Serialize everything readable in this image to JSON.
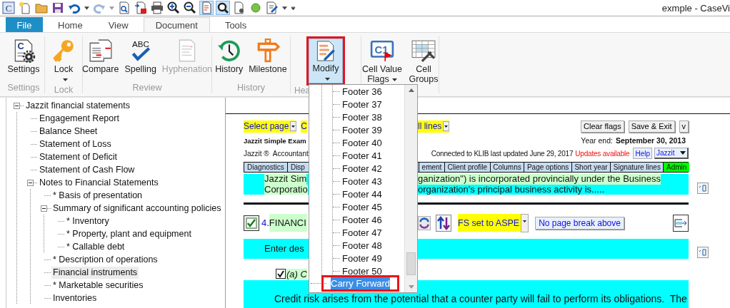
{
  "app_icon_text": "C",
  "window": {
    "title": "exmple - CaseVi"
  },
  "ribbon_tabs": [
    {
      "label": "File",
      "kind": "menu",
      "selected": false
    },
    {
      "label": "Home",
      "kind": "tab",
      "selected": false
    },
    {
      "label": "View",
      "kind": "tab",
      "selected": false
    },
    {
      "label": "Document",
      "kind": "tab",
      "selected": true
    },
    {
      "label": "Tools",
      "kind": "tab",
      "selected": false
    }
  ],
  "ribbon_groups": [
    {
      "label": "Settings",
      "buttons": [
        {
          "label": "Settings",
          "icon_text": "C",
          "dropdown": false,
          "disabled": false,
          "pressed": false,
          "outlined": false
        }
      ]
    },
    {
      "label": "Lock",
      "buttons": [
        {
          "label": "Lock",
          "dropdown": true,
          "disabled": false,
          "pressed": false,
          "outlined": false
        }
      ]
    },
    {
      "label": "Review",
      "buttons": [
        {
          "label": "Compare",
          "dropdown": false,
          "disabled": false,
          "pressed": false,
          "outlined": false
        },
        {
          "label": "Spelling",
          "icon_text": "ABC",
          "dropdown": false,
          "disabled": false,
          "pressed": false,
          "outlined": false
        },
        {
          "label": "Hyphenation",
          "dropdown": false,
          "disabled": true,
          "pressed": false,
          "outlined": false
        }
      ]
    },
    {
      "label": "History",
      "buttons": [
        {
          "label": "History",
          "dropdown": false,
          "disabled": false,
          "pressed": false,
          "outlined": false
        },
        {
          "label": "Milestone",
          "dropdown": false,
          "disabled": false,
          "pressed": false,
          "outlined": false
        }
      ]
    },
    {
      "label": "Hea",
      "buttons": [
        {
          "label": "Modify",
          "dropdown": true,
          "disabled": false,
          "pressed": true,
          "outlined": true
        }
      ]
    },
    {
      "buttons": [
        {
          "label": "Cell Value Flags",
          "icon_text": "C1",
          "dropdown": true,
          "disabled": false,
          "pressed": false,
          "outlined": false
        },
        {
          "label": "Cell Groups",
          "dropdown": false,
          "disabled": false,
          "pressed": false,
          "outlined": false
        }
      ]
    }
  ],
  "tree": [
    {
      "label": "Jazzit financial statements",
      "expanded": true,
      "selected": false,
      "children": [
        {
          "label": "Engagement Report",
          "selected": false
        },
        {
          "label": "Balance Sheet",
          "selected": false
        },
        {
          "label": "Statement of Loss",
          "selected": false
        },
        {
          "label": "Statement of Deficit",
          "selected": false
        },
        {
          "label": "Statement of Cash Flow",
          "selected": false
        },
        {
          "label": "Notes to Financial Statements",
          "expanded": true,
          "selected": false,
          "children": [
            {
              "label": "* Basis of presentation",
              "selected": false
            },
            {
              "label": "Summary of significant accounting policies",
              "expanded": true,
              "selected": false,
              "children": [
                {
                  "label": "* Inventory",
                  "selected": false
                },
                {
                  "label": "* Property, plant and equipment",
                  "selected": false
                },
                {
                  "label": "* Callable debt",
                  "selected": false
                }
              ]
            },
            {
              "label": "* Description of operations",
              "selected": false
            },
            {
              "label": "Financial instruments",
              "selected": true
            },
            {
              "label": "* Marketable securities",
              "selected": false
            },
            {
              "label": "Inventories",
              "selected": false
            }
          ]
        }
      ]
    }
  ],
  "modify_menu": {
    "footers": [
      {
        "label": "Footer 36",
        "selected": false
      },
      {
        "label": "Footer 37",
        "selected": false
      },
      {
        "label": "Footer 38",
        "selected": false
      },
      {
        "label": "Footer 39",
        "selected": false
      },
      {
        "label": "Footer 40",
        "selected": false
      },
      {
        "label": "Footer 41",
        "selected": false
      },
      {
        "label": "Footer 42",
        "selected": false
      },
      {
        "label": "Footer 43",
        "selected": false
      },
      {
        "label": "Footer 44",
        "selected": false
      },
      {
        "label": "Footer 45",
        "selected": false
      },
      {
        "label": "Footer 46",
        "selected": false
      },
      {
        "label": "Footer 47",
        "selected": false
      },
      {
        "label": "Footer 48",
        "selected": false
      },
      {
        "label": "Footer 49",
        "selected": false
      },
      {
        "label": "Footer 50",
        "selected": false
      }
    ],
    "items": [
      {
        "label": "Carry Forward",
        "selected": true,
        "outlined": true
      }
    ]
  },
  "document": {
    "page_select": "Select page",
    "left_select": "C",
    "right_select": "ll lines",
    "toolbar_buttons": [
      "Clear flags",
      "Save & Exit",
      "v"
    ],
    "client_name": "Jazzit Simple Exam",
    "year_end_label": "Year end:",
    "year_end": "September 30, 2013",
    "brand": "Jazzit ®  Accountant",
    "connection": "Connected to KLIB last updated June 29, 2017",
    "updates": "Updates available",
    "help": "Help",
    "menu": "Jazzit",
    "tabs_left": [
      {
        "label": "Diagnostics",
        "kind": "tab"
      },
      {
        "label": "Disp",
        "kind": "tab"
      }
    ],
    "tabs_right": [
      {
        "label": "ement",
        "kind": "tab"
      },
      {
        "label": "Client profile",
        "kind": "tab"
      },
      {
        "label": "Columns",
        "kind": "tab"
      },
      {
        "label": "Page options",
        "kind": "tab"
      },
      {
        "label": "Short year",
        "kind": "tab"
      },
      {
        "label": "Signature lines",
        "kind": "tab"
      },
      {
        "label": "Admin",
        "kind": "admin"
      }
    ],
    "intro": {
      "left_lines": [
        {
          "text": "Jazzit Sim",
          "highlighted": true
        },
        {
          "text": "Corporatio",
          "highlighted": true
        }
      ],
      "right_lines": [
        {
          "text": "ganization\") is incorporated provincially under the Business",
          "highlighted": true
        },
        {
          "text": "organization's principal business activity is.....",
          "highlighted": false
        }
      ]
    },
    "section": {
      "checked": true,
      "number": "4.",
      "title": "FINANCI",
      "framework": "FS set to ASPE",
      "page_break": "No page break above"
    },
    "description": "Enter des",
    "subsection": {
      "checked": true,
      "title": "(a) C"
    },
    "body": "Credit risk arises from the potential that a counter party will fail to perform its obligations.  The"
  }
}
